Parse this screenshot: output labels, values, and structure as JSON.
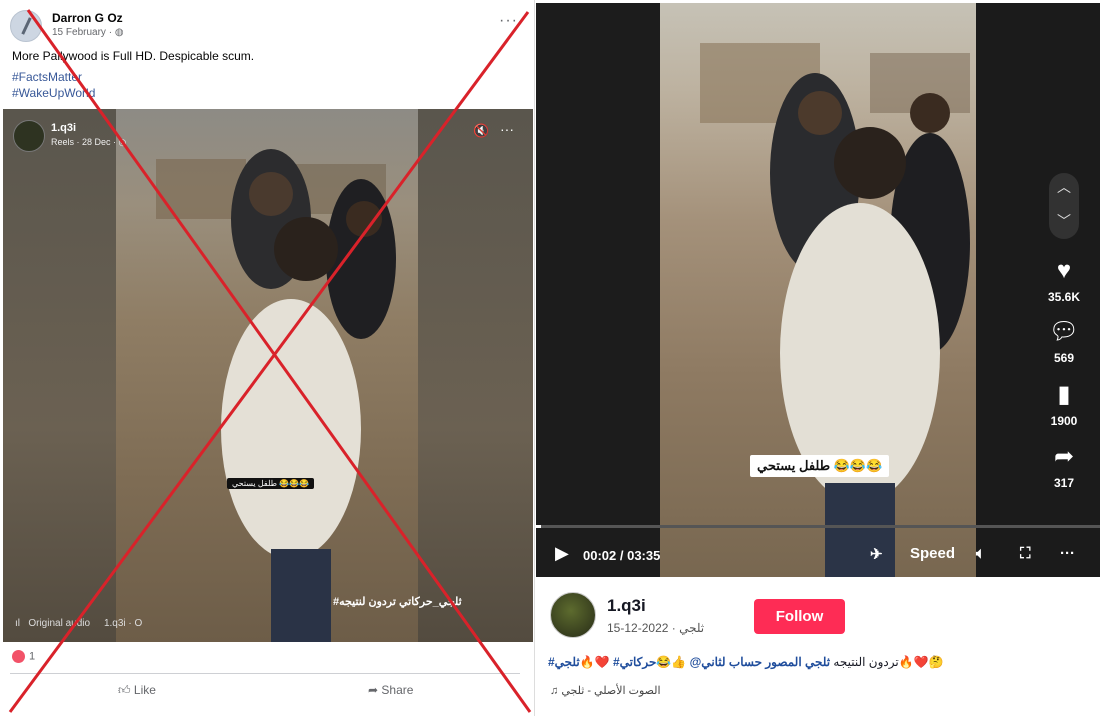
{
  "facebook": {
    "author_name": "Darron G Oz",
    "post_date": "15 February · ",
    "globe_icon": "globe-icon",
    "more": "···",
    "text": "More Pallywood is Full HD. Despicable scum.",
    "hashtags": [
      "#FactsMatter",
      "#WakeUpWorld"
    ],
    "reel": {
      "username": "1.q3i",
      "meta": "Reels · 28 Dec · ",
      "caption": "طلفل يستحي 😂😂😂",
      "overlay_text": "#ثلجي_حركاتي تردون لنتيجه",
      "audio_label": "Original audio",
      "audio_user": "1.q3i · O"
    },
    "reaction_count": "1",
    "like_label": "Like",
    "share_label": "Share"
  },
  "tiktok": {
    "overlay_caption": "طلفل يستحي 😂😂😂",
    "likes": "35.6K",
    "comments": "569",
    "saves": "1900",
    "shares": "317",
    "time": "00:02 / 03:35",
    "progress": 0.009,
    "speed_label": "Speed",
    "username": "1.q3i",
    "subline": "ثلجي · 2022-12-15",
    "follow_label": "Follow",
    "description_prefix": "🤔❤️🔥تردون النتيجه",
    "description_link": "ثلجي المصور حساب لثاني@",
    "description_suffix": " 👍😂حركاتي# ❤️🔥ثلجي#",
    "music": "الصوت الأصلي - ثلجي"
  },
  "colors": {
    "accent": "#fe2c55",
    "link": "#385898",
    "cross": "#d9222a"
  }
}
